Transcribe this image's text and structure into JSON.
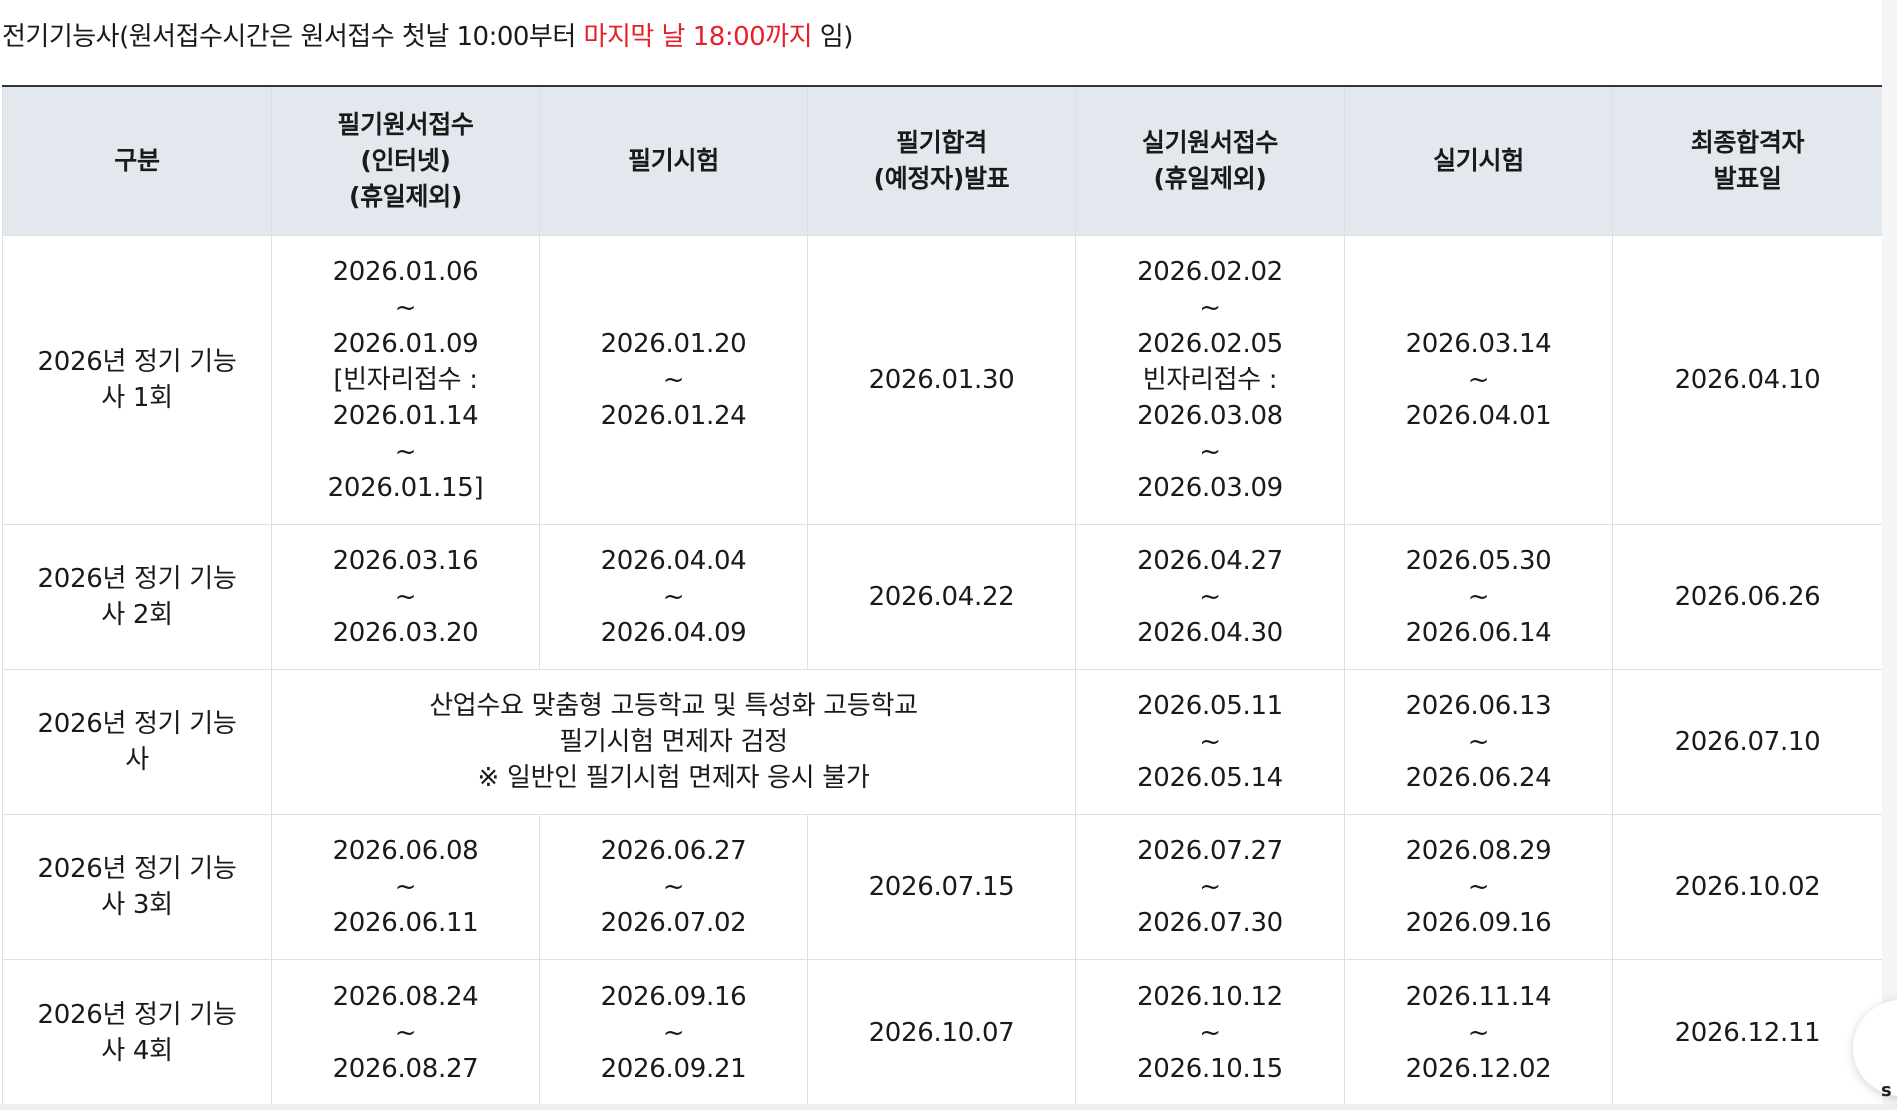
{
  "heading": {
    "prefix": "전기기능사(원서접수시간은 원서접수 첫날 10:00부터 ",
    "highlight": "마지막 날 18:00까지",
    "suffix": " 임)",
    "highlight_color": "#e8202a"
  },
  "table": {
    "headers": [
      [
        "구분"
      ],
      [
        "필기원서접수",
        "(인터넷)",
        "(휴일제외)"
      ],
      [
        "필기시험"
      ],
      [
        "필기합격",
        "(예정자)발표"
      ],
      [
        "실기원서접수",
        "(휴일제외)"
      ],
      [
        "실기시험"
      ],
      [
        "최종합격자",
        "발표일"
      ]
    ],
    "rows": [
      {
        "label": [
          "2026년 정기 기능",
          "사 1회"
        ],
        "written_apply": [
          "2026.01.06",
          "~",
          "2026.01.09",
          "[빈자리접수 :",
          "2026.01.14",
          "~",
          "2026.01.15]"
        ],
        "written_exam": [
          "2026.01.20",
          "~",
          "2026.01.24"
        ],
        "written_result": [
          "2026.01.30"
        ],
        "practical_apply": [
          "2026.02.02",
          "~",
          "2026.02.05",
          "빈자리접수 :",
          "2026.03.08",
          "~",
          "2026.03.09"
        ],
        "practical_exam": [
          "2026.03.14",
          "~",
          "2026.04.01"
        ],
        "final_result": [
          "2026.04.10"
        ]
      },
      {
        "label": [
          "2026년 정기 기능",
          "사 2회"
        ],
        "written_apply": [
          "2026.03.16",
          "~",
          "2026.03.20"
        ],
        "written_exam": [
          "2026.04.04",
          "~",
          "2026.04.09"
        ],
        "written_result": [
          "2026.04.22"
        ],
        "practical_apply": [
          "2026.04.27",
          "~",
          "2026.04.30"
        ],
        "practical_exam": [
          "2026.05.30",
          "~",
          "2026.06.14"
        ],
        "final_result": [
          "2026.06.26"
        ]
      },
      {
        "label": [
          "2026년 정기 기능",
          "사"
        ],
        "merged_note": [
          "산업수요 맞춤형 고등학교 및 특성화 고등학교",
          "필기시험 면제자 검정",
          "※ 일반인 필기시험 면제자 응시 불가"
        ],
        "practical_apply": [
          "2026.05.11",
          "~",
          "2026.05.14"
        ],
        "practical_exam": [
          "2026.06.13",
          "~",
          "2026.06.24"
        ],
        "final_result": [
          "2026.07.10"
        ]
      },
      {
        "label": [
          "2026년 정기 기능",
          "사 3회"
        ],
        "written_apply": [
          "2026.06.08",
          "~",
          "2026.06.11"
        ],
        "written_exam": [
          "2026.06.27",
          "~",
          "2026.07.02"
        ],
        "written_result": [
          "2026.07.15"
        ],
        "practical_apply": [
          "2026.07.27",
          "~",
          "2026.07.30"
        ],
        "practical_exam": [
          "2026.08.29",
          "~",
          "2026.09.16"
        ],
        "final_result": [
          "2026.10.02"
        ]
      },
      {
        "label": [
          "2026년 정기 기능",
          "사 4회"
        ],
        "written_apply": [
          "2026.08.24",
          "~",
          "2026.08.27"
        ],
        "written_exam": [
          "2026.09.16",
          "~",
          "2026.09.21"
        ],
        "written_result": [
          "2026.10.07"
        ],
        "practical_apply": [
          "2026.10.12",
          "~",
          "2026.10.15"
        ],
        "practical_exam": [
          "2026.11.14",
          "~",
          "2026.12.02"
        ],
        "final_result": [
          "2026.12.11"
        ]
      }
    ]
  },
  "floating_button": {
    "glyph": "s"
  }
}
